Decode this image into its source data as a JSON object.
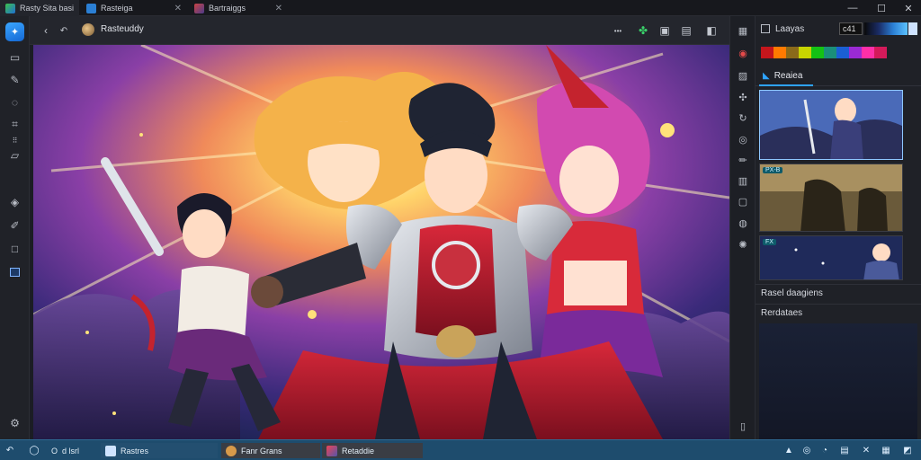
{
  "tabs": [
    {
      "label": "Rasty Sita basi",
      "icon": "app-icon"
    },
    {
      "label": "Rasteiga",
      "icon": "document-icon"
    },
    {
      "label": "Bartraiggs",
      "icon": "image-icon"
    }
  ],
  "window_controls": [
    "—",
    "☐",
    "✕"
  ],
  "header": {
    "title": "Rasteuddy",
    "more_label": "•••"
  },
  "right_panel": {
    "layers_label": "Laayas",
    "color_value": "c41",
    "palette": [
      "#c4161c",
      "#ff7a00",
      "#8a6a1a",
      "#c7d400",
      "#14c214",
      "#1a8f7a",
      "#1a5fd4",
      "#9a2ad4",
      "#ff2fa8",
      "#d41a5a"
    ],
    "tab_label": "Reaiea",
    "thumbnails": [
      {
        "tag": ""
      },
      {
        "tag": "PX-B"
      },
      {
        "tag": "FX"
      }
    ],
    "sections": [
      "Rasel daagiens",
      "Rerdataes"
    ]
  },
  "taskbar": {
    "search_label": "d lsrl",
    "search_prefix": "O",
    "windows": [
      {
        "label": "Rastres"
      },
      {
        "label": "Fanr Grans"
      },
      {
        "label": "Retaddie"
      }
    ]
  },
  "colors": {
    "accent": "#2ea3ff",
    "taskbar": "#1e4c6d",
    "panel": "#1f2127"
  }
}
